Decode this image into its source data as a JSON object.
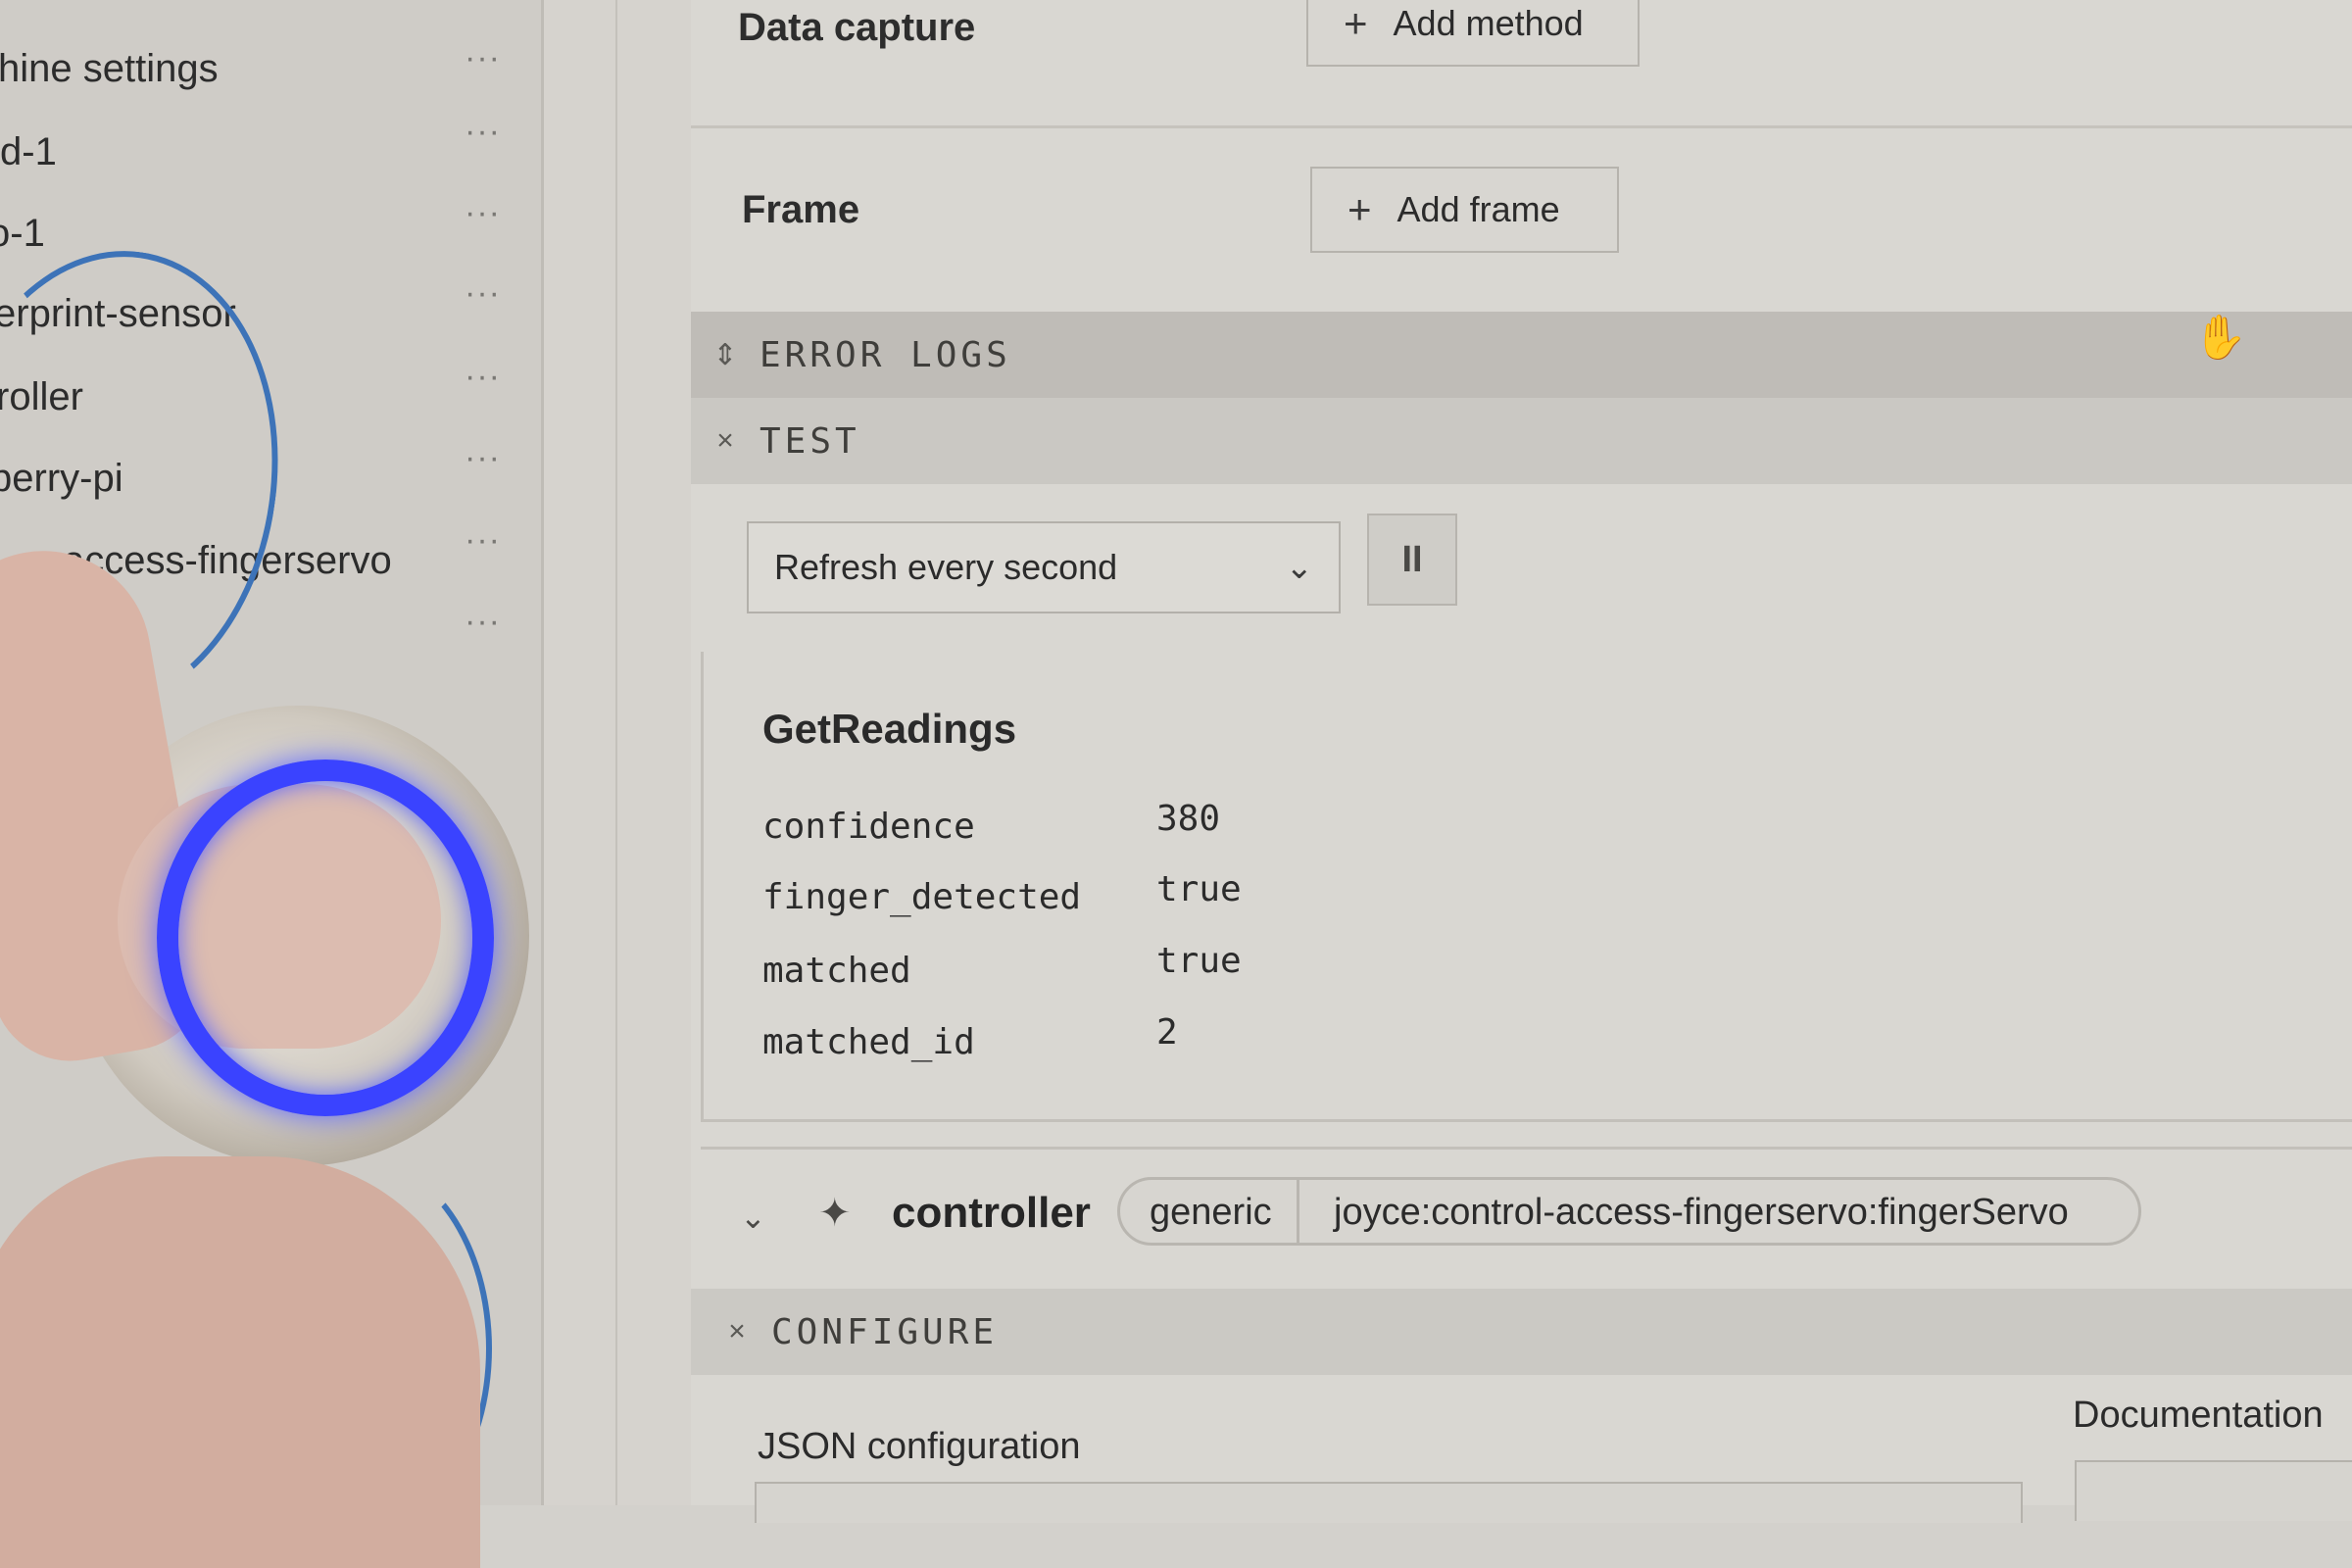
{
  "sidebar": {
    "items": [
      {
        "label": "hine settings"
      },
      {
        "label": "d-1"
      },
      {
        "label": "o-1"
      },
      {
        "label": "erprint-sensor"
      },
      {
        "label": "roller"
      },
      {
        "label": "berry-pi"
      },
      {
        "label": "access-fingerservo"
      },
      {
        "label": ""
      }
    ],
    "more_label": "···"
  },
  "data_capture": {
    "title": "Data capture",
    "add_label": "Add method"
  },
  "frame": {
    "title": "Frame",
    "add_label": "Add frame"
  },
  "sections": {
    "error_logs": "ERROR LOGS",
    "test": "TEST",
    "configure": "CONFIGURE"
  },
  "test": {
    "refresh_select": {
      "value": "Refresh every second"
    },
    "pause_label": "II"
  },
  "readings": {
    "title": "GetReadings",
    "rows": [
      {
        "key": "confidence",
        "value": "380"
      },
      {
        "key": "finger_detected",
        "value": "true"
      },
      {
        "key": "matched",
        "value": "true"
      },
      {
        "key": "matched_id",
        "value": "2"
      }
    ]
  },
  "controller": {
    "name": "controller",
    "type": "generic",
    "model": "joyce:control-access-fingerservo:fingerServo"
  },
  "configure": {
    "json_label": "JSON configuration",
    "docs_label": "Documentation"
  },
  "colors": {
    "led_ring": "#3a43ff",
    "wire": "#3d73b8"
  }
}
